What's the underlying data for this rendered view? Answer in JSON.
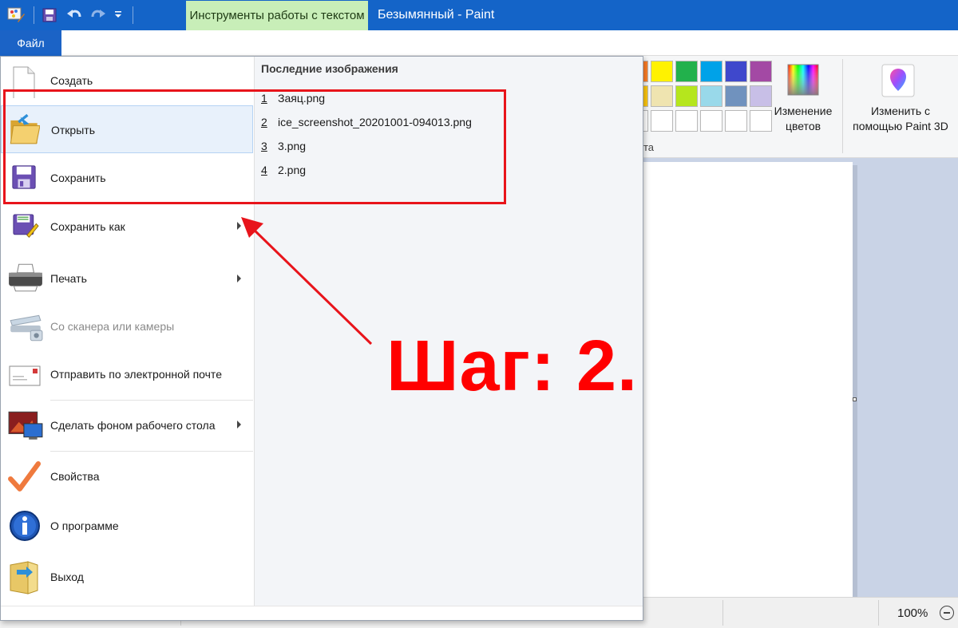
{
  "window": {
    "app_title": "Безымянный - Paint",
    "context_tab": "Инструменты работы с текстом",
    "file_tab": "Файл"
  },
  "file_menu": {
    "items": [
      {
        "label": "Создать",
        "icon": "new-page-icon"
      },
      {
        "label": "Открыть",
        "icon": "open-folder-icon"
      },
      {
        "label": "Сохранить",
        "icon": "save-disk-icon"
      },
      {
        "label": "Сохранить как",
        "icon": "save-as-icon"
      },
      {
        "label": "Печать",
        "icon": "printer-icon"
      },
      {
        "label": "Со сканера или камеры",
        "icon": "scanner-icon"
      },
      {
        "label": "Отправить по электронной почте",
        "icon": "email-icon"
      },
      {
        "label": "Сделать фоном рабочего стола",
        "icon": "desktop-background-icon"
      },
      {
        "label": "Свойства",
        "icon": "checkmark-icon"
      },
      {
        "label": "О программе",
        "icon": "info-icon"
      },
      {
        "label": "Выход",
        "icon": "exit-icon"
      }
    ]
  },
  "recent": {
    "title": "Последние изображения",
    "files": [
      {
        "num": "1",
        "name": "Заяц.png"
      },
      {
        "num": "2",
        "name": "ice_screenshot_20201001-094013.png"
      },
      {
        "num": "3",
        "name": "3.png"
      },
      {
        "num": "4",
        "name": "2.png"
      }
    ]
  },
  "ribbon": {
    "edit_colors_line1": "Изменение",
    "edit_colors_line2": "цветов",
    "paint3d_line1": "Изменить с",
    "paint3d_line2": "помощью Paint 3D",
    "group_label_fragment": "та",
    "palette_row1": [
      "#ff7f27",
      "#fff200",
      "#22b14c",
      "#00a2e8",
      "#3f48cc",
      "#a349a4"
    ],
    "palette_row2": [
      "#ffc90e",
      "#efe4b0",
      "#b5e61d",
      "#99d9ea",
      "#7092be",
      "#c8bfe7"
    ]
  },
  "status": {
    "zoom": "100%"
  },
  "annotation": {
    "text": "Шаг: 2.",
    "color": "#ff0000"
  }
}
